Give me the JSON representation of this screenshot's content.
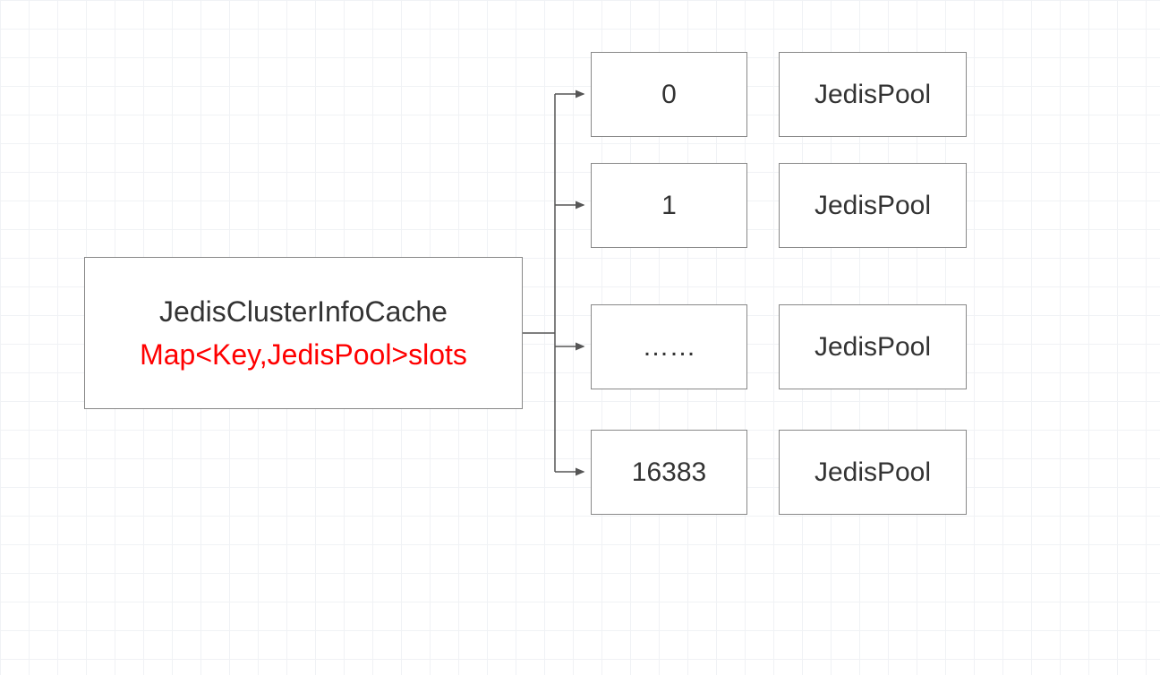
{
  "main": {
    "title": "JedisClusterInfoCache",
    "subtitle": "Map<Key,JedisPool>slots"
  },
  "rows": [
    {
      "slot": "0",
      "pool": "JedisPool"
    },
    {
      "slot": "1",
      "pool": "JedisPool"
    },
    {
      "slot": "……",
      "pool": "JedisPool"
    },
    {
      "slot": "16383",
      "pool": "JedisPool"
    }
  ]
}
